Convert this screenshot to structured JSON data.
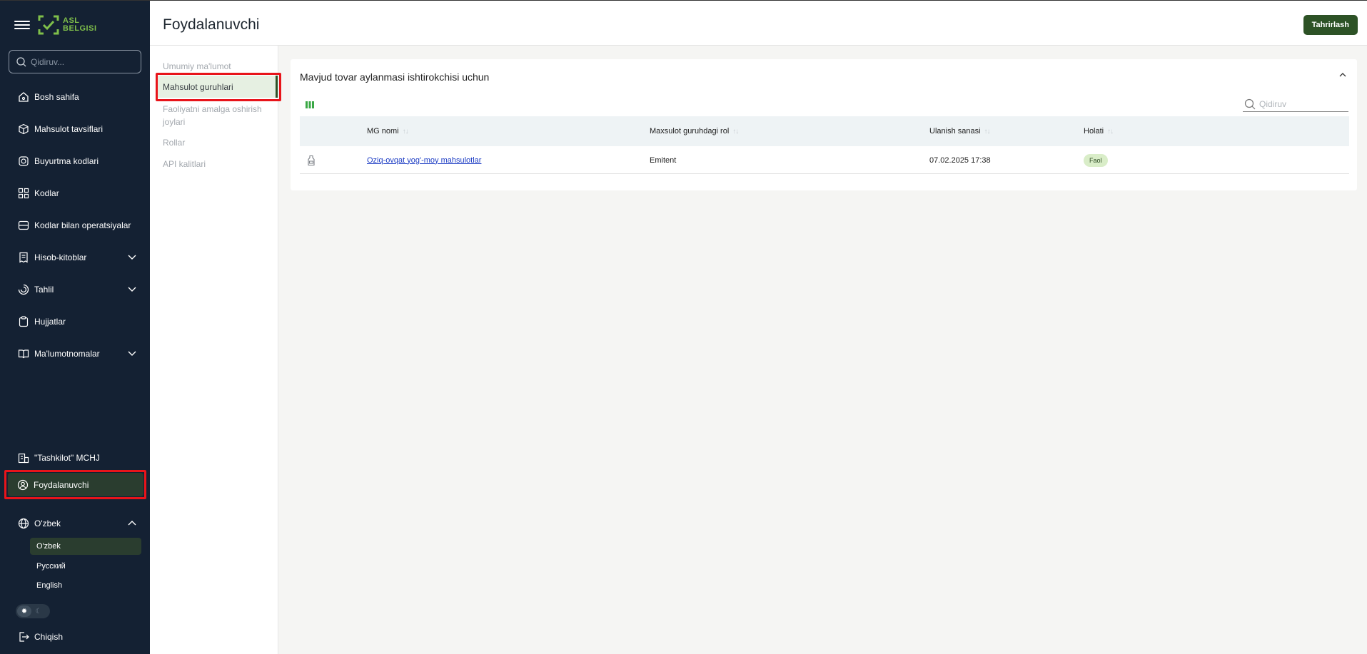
{
  "brand": {
    "logo_text_1": "ASL",
    "logo_text_2": "BELGISI"
  },
  "sidebar": {
    "search_placeholder": "Qidiruv...",
    "items": [
      {
        "label": "Bosh sahifa",
        "icon": "home-icon"
      },
      {
        "label": "Mahsulot tavsiflari",
        "icon": "cube-icon"
      },
      {
        "label": "Buyurtma kodlari",
        "icon": "order-codes-icon"
      },
      {
        "label": "Kodlar",
        "icon": "codes-icon"
      },
      {
        "label": "Kodlar bilan operatsiyalar",
        "icon": "operations-icon"
      },
      {
        "label": "Hisob-kitoblar",
        "icon": "receipt-icon"
      },
      {
        "label": "Tahlil",
        "icon": "analytics-icon"
      },
      {
        "label": "Hujjatlar",
        "icon": "documents-icon"
      },
      {
        "label": "Ma'lumotnomalar",
        "icon": "book-icon"
      }
    ],
    "organization": "\"Tashkilot\" MCHJ",
    "user": "Foydalanuvchi",
    "language": "O'zbek",
    "languages": [
      "O'zbek",
      "Русский",
      "English"
    ],
    "logout": "Chiqish"
  },
  "header": {
    "title": "Foydalanuvchi",
    "edit_button": "Tahrirlash"
  },
  "subnav": {
    "items": [
      "Umumiy ma'lumot",
      "Mahsulot guruhlari",
      "Faoliyatni amalga oshirish joylari",
      "Rollar",
      "API kalitlari"
    ],
    "active": "Mahsulot guruhlari"
  },
  "card": {
    "title": "Mavjud tovar aylanmasi ishtirokchisi uchun",
    "search_placeholder": "Qidiruv",
    "columns": [
      "MG nomi",
      "Maxsulot guruhdagi rol",
      "Ulanish sanasi",
      "Holati"
    ],
    "rows": [
      {
        "icon": "food-product-icon",
        "name": "Oziq-ovqat yog'-moy mahsulotlar",
        "role": "Emitent",
        "date": "07.02.2025 17:38",
        "status": "Faol"
      }
    ]
  },
  "colors": {
    "sidebar_bg": "#142133",
    "accent": "#2d5226",
    "brand_green": "#7fbf4a",
    "highlight": "#e8141a",
    "badge_bg": "#d9edc8"
  }
}
